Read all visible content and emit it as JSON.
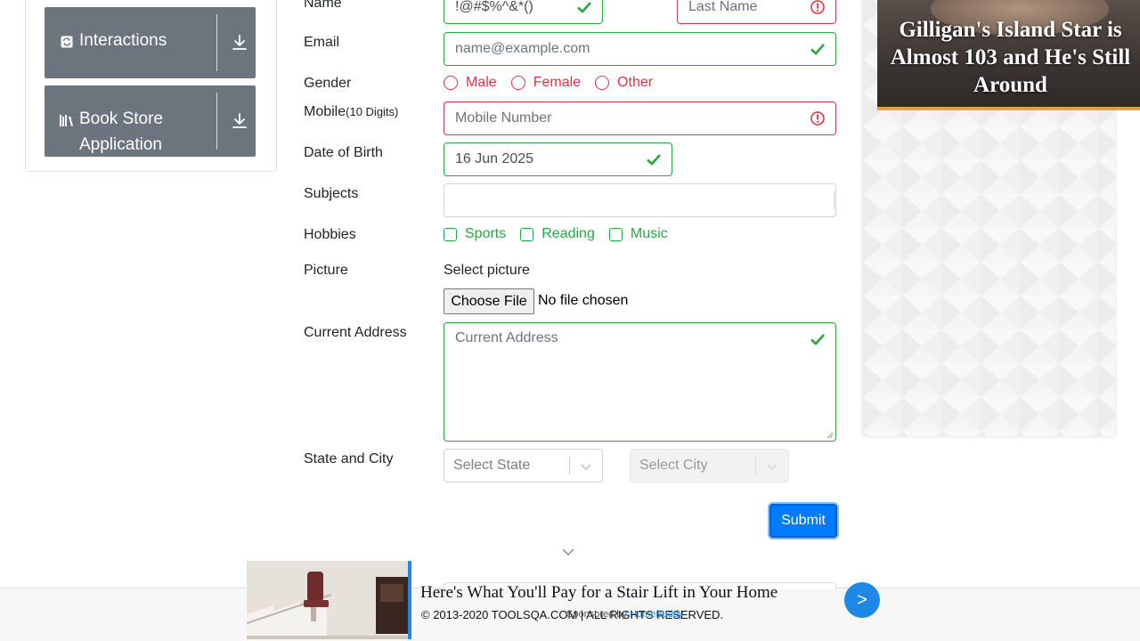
{
  "sidebar": {
    "groups": [
      {
        "label": "Interactions",
        "icon": "interactions-icon"
      },
      {
        "label": "Book Store",
        "label2": "Application",
        "icon": "book-store-icon"
      }
    ]
  },
  "form": {
    "name": {
      "label": "Name",
      "first_value": "!@#$%^&*()",
      "last_placeholder": "Last Name"
    },
    "email": {
      "label": "Email",
      "placeholder": "name@example.com"
    },
    "gender": {
      "label": "Gender",
      "options": [
        "Male",
        "Female",
        "Other"
      ]
    },
    "mobile": {
      "label": "Mobile",
      "label_hint": "(10 Digits)",
      "placeholder": "Mobile Number"
    },
    "dob": {
      "label": "Date of Birth",
      "value": "16 Jun 2025"
    },
    "subjects": {
      "label": "Subjects"
    },
    "hobbies": {
      "label": "Hobbies",
      "options": [
        "Sports",
        "Reading",
        "Music"
      ]
    },
    "picture": {
      "label": "Picture",
      "select_label": "Select picture",
      "button": "Choose File",
      "status": "No file chosen"
    },
    "address": {
      "label": "Current Address",
      "placeholder": "Current Address"
    },
    "state_city": {
      "label": "State and City",
      "state_placeholder": "Select State",
      "city_placeholder": "Select City"
    },
    "submit": "Submit"
  },
  "ads": {
    "right_headline": "Gilligan's Island Star is Almost 103 and He's Still Around",
    "bottom_title": "Here's What You'll Pay for a Stair Lift in Your Home",
    "sponsor_prefix": "Sponsored by ",
    "sponsor_brand": "HomeBuddy",
    "next_arrow": ">"
  },
  "footer": {
    "text": "© 2013-2020 TOOLSQA.COM | ALL RIGHTS RESERVED."
  },
  "colors": {
    "valid": "#28a745",
    "invalid": "#dc3545",
    "primary": "#007bff",
    "sidebar_header": "#6c757d"
  }
}
